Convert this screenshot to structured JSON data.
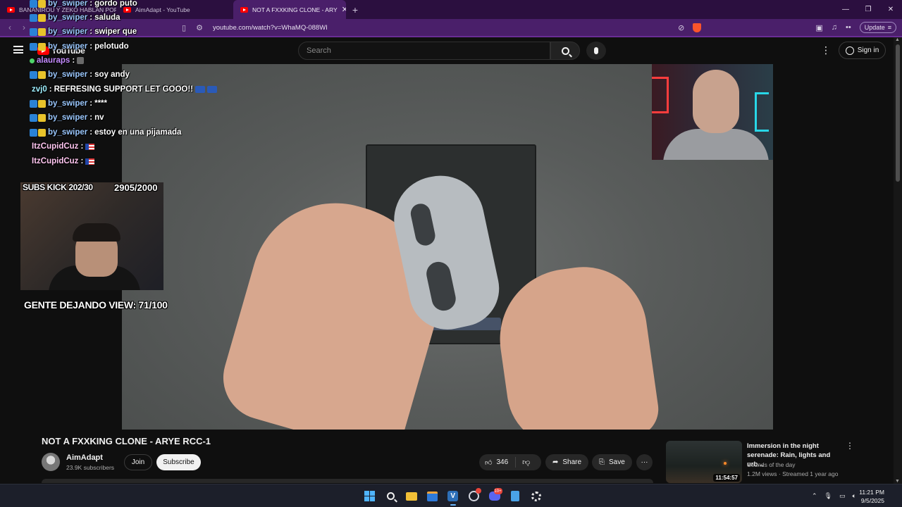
{
  "browser": {
    "tabs": [
      {
        "title": "BANANIROU Y ZEKO HABLAN POR"
      },
      {
        "title": "AimAdapt - YouTube"
      },
      {
        "title": "NOT A FXXKING CLONE - ARY",
        "close": "✕",
        "active": true
      }
    ],
    "new_tab": "+",
    "window_controls": [
      "—",
      "❐",
      "✕"
    ],
    "url": "youtube.com/watch?v=WhaMQ-088WI",
    "update_label": "Update",
    "update_menu": "≡",
    "shield_count": "10"
  },
  "youtube": {
    "logo_text": "YouTube",
    "search_placeholder": "Search",
    "sign_in": "Sign in"
  },
  "stream_overlay": {
    "chat": [
      {
        "user": "by_swiper",
        "message": "gordo puto",
        "badges": true,
        "color": "blue"
      },
      {
        "user": "by_swiper",
        "message": "saluda",
        "badges": true,
        "color": "blue"
      },
      {
        "user": "by_swiper",
        "message": "swiper que",
        "badges": true,
        "color": "blue"
      },
      {
        "user": "by_swiper",
        "message": "pelotudo",
        "badges": true,
        "color": "blue"
      },
      {
        "user": "alauraps",
        "message": "",
        "badges": false,
        "color": "purple"
      },
      {
        "user": "by_swiper",
        "message": "soy andy",
        "badges": true,
        "color": "blue"
      },
      {
        "user": "zvj0",
        "message": "REFRESING SUPPORT LET GOOO!!",
        "badges": false,
        "color": "cyan"
      },
      {
        "user": "by_swiper",
        "message": "****",
        "badges": true,
        "color": "blue"
      },
      {
        "user": "by_swiper",
        "message": "nv",
        "badges": true,
        "color": "blue"
      },
      {
        "user": "by_swiper",
        "message": "estoy en una pijamada",
        "badges": true,
        "color": "blue"
      },
      {
        "user": "ItzCupidCuz",
        "message": "",
        "badges": false,
        "color": "pink"
      },
      {
        "user": "ItzCupidCuz",
        "message": "",
        "badges": false,
        "color": "pink"
      }
    ],
    "chat_separator": ":",
    "subs_kick": "SUBS KICK 202/30",
    "sub_goal": "2905/2000",
    "viewers_leaving": "GENTE DEJANDO VIEW: 71/100"
  },
  "video": {
    "title": "NOT A FXXKING CLONE - ARYE RCC-1",
    "channel": "AimAdapt",
    "subscribers": "23.9K subscribers",
    "join": "Join",
    "subscribe": "Subscribe",
    "likes": "346",
    "share": "Share",
    "save": "Save",
    "more": "···"
  },
  "recommendation": {
    "title": "Immersion in the night serenade: Rain, lights and urb...",
    "channel": "Sounds of the day",
    "meta": "1.2M views · Streamed 1 year ago",
    "duration": "11:54:57"
  },
  "taskbar": {
    "time": "11:21 PM",
    "date": "9/5/2025",
    "discord_badge": "10+"
  },
  "colors": {
    "browser_tab_bg": "#2b0f3f",
    "browser_toolbar_bg": "#4a1f6a",
    "yt_red": "#ff0000",
    "yt_bg": "#0f0f0f"
  }
}
